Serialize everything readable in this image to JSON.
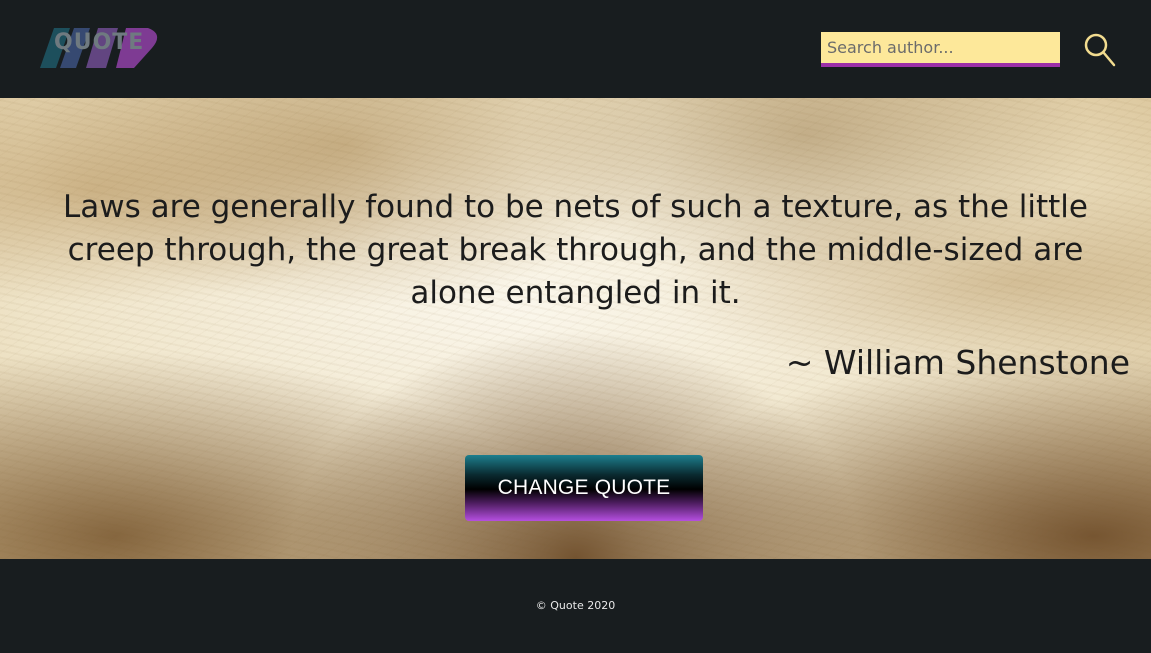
{
  "header": {
    "logo_text": "QUOTE",
    "search": {
      "placeholder": "Search author...",
      "value": "",
      "icon": "search-icon"
    }
  },
  "quote": {
    "text": "Laws are generally found to be nets of such a texture, as the little creep through, the great break through, and the middle-sized are alone entangled in it.",
    "author": "~ William Shenstone"
  },
  "actions": {
    "change_quote_label": "CHANGE QUOTE"
  },
  "footer": {
    "copyright": "© Quote 2020"
  },
  "colors": {
    "background_dark": "#181d1f",
    "search_field": "#fde89a",
    "search_underline": "#9c2fa8",
    "search_icon": "#f2dc8f",
    "button_top": "#1d7f8e",
    "button_bottom": "#b54fe0"
  }
}
